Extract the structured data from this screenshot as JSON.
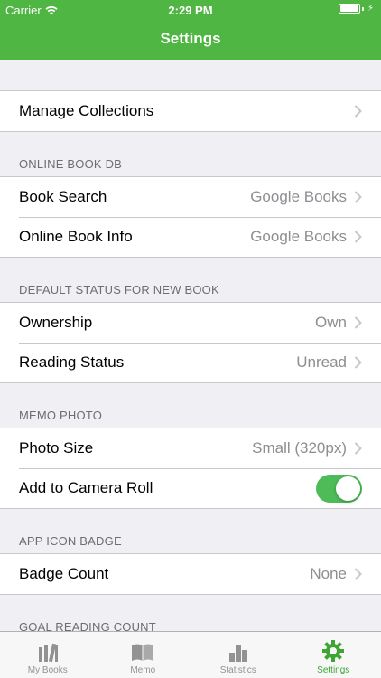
{
  "status": {
    "carrier": "Carrier",
    "time": "2:29 PM"
  },
  "nav": {
    "title": "Settings"
  },
  "sections": {
    "manage": {
      "label": "Manage Collections"
    },
    "online": {
      "header": "ONLINE BOOK DB",
      "book_search": {
        "label": "Book Search",
        "value": "Google Books"
      },
      "online_info": {
        "label": "Online Book Info",
        "value": "Google Books"
      }
    },
    "default_status": {
      "header": "DEFAULT STATUS FOR NEW BOOK",
      "ownership": {
        "label": "Ownership",
        "value": "Own"
      },
      "reading": {
        "label": "Reading Status",
        "value": "Unread"
      }
    },
    "memo_photo": {
      "header": "MEMO PHOTO",
      "photo_size": {
        "label": "Photo Size",
        "value": "Small (320px)"
      },
      "camera_roll": {
        "label": "Add to Camera Roll",
        "on": true
      }
    },
    "badge": {
      "header": "APP ICON BADGE",
      "badge_count": {
        "label": "Badge Count",
        "value": "None"
      }
    },
    "goal": {
      "header": "GOAL READING COUNT"
    }
  },
  "tabs": [
    {
      "label": "My Books",
      "icon": "books-icon"
    },
    {
      "label": "Memo",
      "icon": "memo-book-icon"
    },
    {
      "label": "Statistics",
      "icon": "bar-chart-icon"
    },
    {
      "label": "Settings",
      "icon": "gear-icon",
      "active": true
    }
  ],
  "colors": {
    "nav": "#4fb543",
    "accent": "#3ea534",
    "toggle": "#4cbb58"
  }
}
